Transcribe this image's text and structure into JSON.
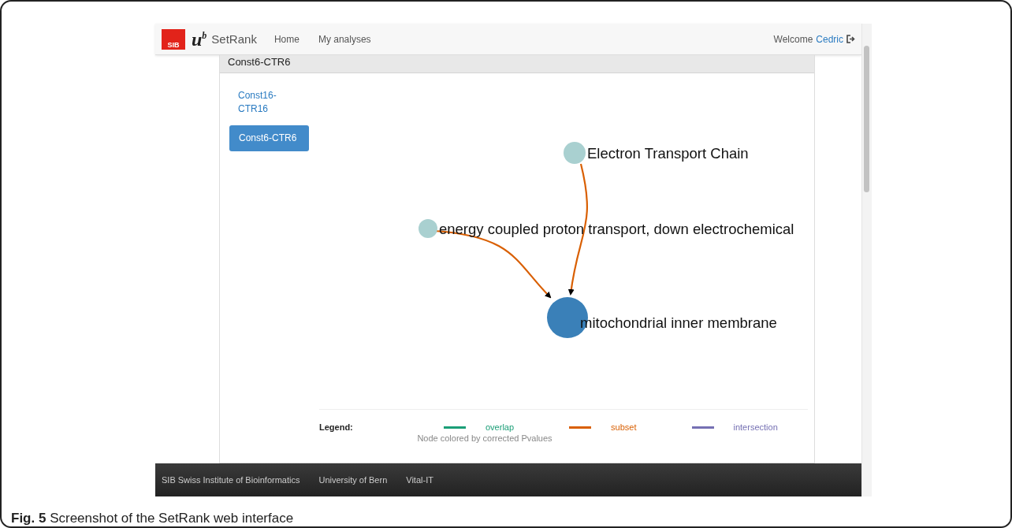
{
  "navbar": {
    "logo_text": "SIB",
    "uni_letter": "u",
    "uni_sup": "b",
    "brand": "SetRank",
    "links": [
      {
        "label": "Home"
      },
      {
        "label": "My analyses"
      }
    ],
    "welcome": "Welcome",
    "user": "Cedric"
  },
  "panel": {
    "title": "Const6-CTR6",
    "analyses": [
      {
        "label": "Const16-CTR16",
        "selected": false
      },
      {
        "label": "Const6-CTR6",
        "selected": true
      }
    ]
  },
  "graph": {
    "nodes": [
      {
        "label": "Electron Transport Chain",
        "color": "#a9d0d0"
      },
      {
        "label": "energy coupled proton transport, down electrochemical",
        "color": "#a9d0d0"
      },
      {
        "label": "mitochondrial inner membrane",
        "color": "#3a80b8"
      }
    ],
    "edges": [
      {
        "kind": "subset"
      },
      {
        "kind": "subset"
      }
    ]
  },
  "legend": {
    "title": "Legend:",
    "items": [
      {
        "kind": "overlap",
        "label": "overlap",
        "color": "#1b9e77"
      },
      {
        "kind": "subset",
        "label": "subset",
        "color": "#d95f02"
      },
      {
        "kind": "intersection",
        "label": "intersection",
        "color": "#7570b3"
      }
    ],
    "note": "Node colored by corrected Pvalues"
  },
  "footer": {
    "links": [
      {
        "label": "SIB Swiss Institute of Bioinformatics"
      },
      {
        "label": "University of Bern"
      },
      {
        "label": "Vital-IT"
      }
    ]
  },
  "caption": {
    "label": "Fig. 5",
    "text": "Screenshot of the SetRank web interface"
  }
}
